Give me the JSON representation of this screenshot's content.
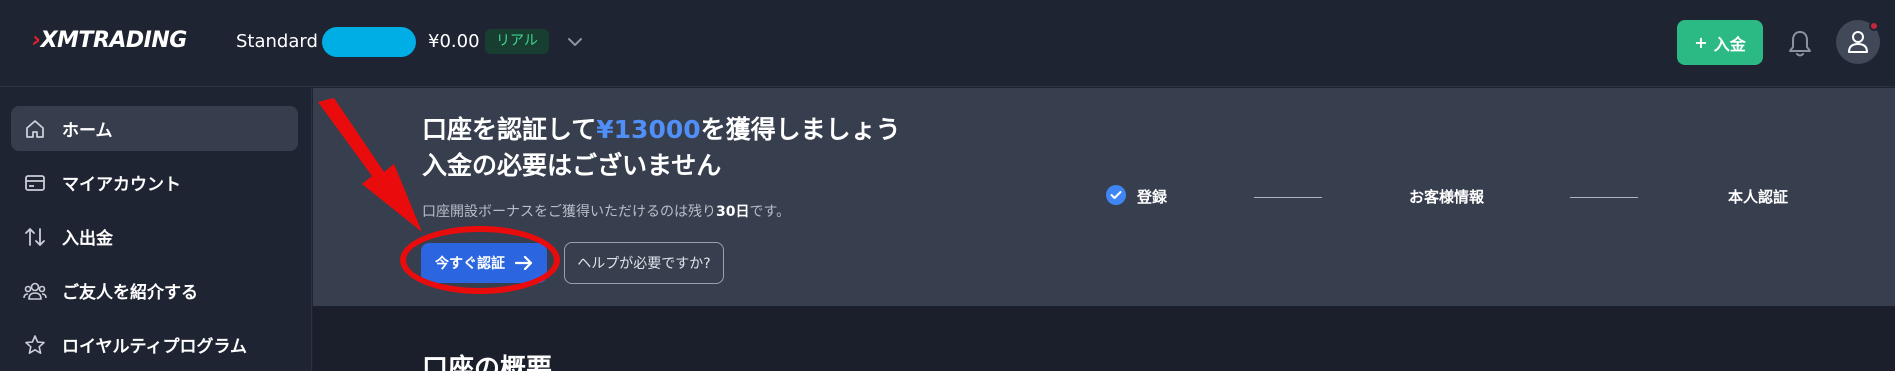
{
  "header": {
    "logo_text": "XMTRADING",
    "account_type": "Standard",
    "balance": "¥0.00",
    "account_badge": "リアル",
    "deposit_button": "入金",
    "deposit_icon": "+"
  },
  "sidebar": {
    "items": [
      {
        "label": "ホーム",
        "icon": "home-icon",
        "active": true
      },
      {
        "label": "マイアカウント",
        "icon": "card-icon",
        "active": false
      },
      {
        "label": "入出金",
        "icon": "transfer-arrows-icon",
        "active": false
      },
      {
        "label": "ご友人を紹介する",
        "icon": "users-icon",
        "active": false
      },
      {
        "label": "ロイヤルティプログラム",
        "icon": "star-icon",
        "active": false
      }
    ]
  },
  "banner": {
    "title_prefix": "口座を認証して",
    "title_amount": "¥13000",
    "title_suffix": "を獲得しましょう",
    "title_line2": "入金の必要はございません",
    "subtitle_prefix": "口座開設ボーナスをご獲得いただけるのは残り",
    "subtitle_days": "30日",
    "subtitle_suffix": "です。",
    "verify_button": "今すぐ認証",
    "help_button": "ヘルプが必要ですか?",
    "steps": [
      {
        "label": "登録",
        "done": true
      },
      {
        "label": "お客様情報",
        "done": false
      },
      {
        "label": "本人認証",
        "done": false
      }
    ]
  },
  "main": {
    "section_title": "口座の概要"
  },
  "colors": {
    "accent_blue": "#2b66e0",
    "amount_blue": "#4f8ff7",
    "deposit_green": "#2cba84",
    "annotation_red": "#ea0c0c",
    "account_mask": "#00aee6"
  }
}
